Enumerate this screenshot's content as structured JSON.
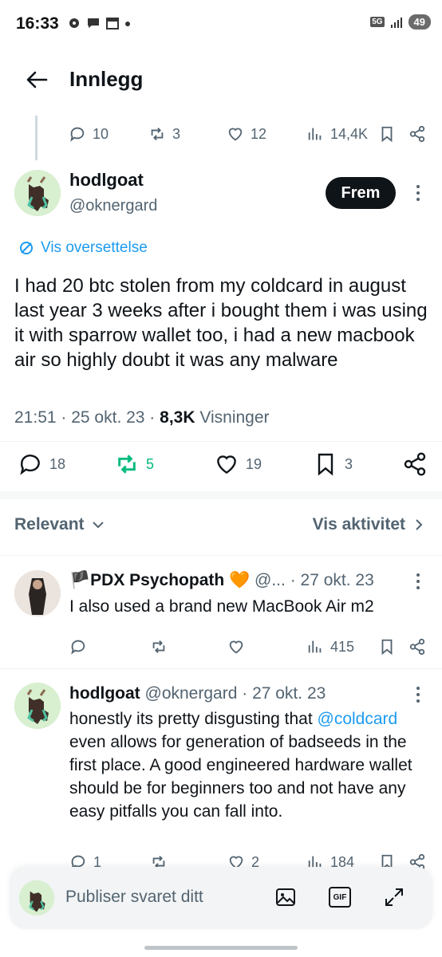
{
  "status_bar": {
    "time": "16:33",
    "net": "5G",
    "battery": "49"
  },
  "header": {
    "title": "Innlegg"
  },
  "parent_metrics": {
    "replies": "10",
    "reposts": "3",
    "likes": "12",
    "views": "14,4K"
  },
  "post": {
    "name": "hodlgoat",
    "handle": "@oknergard",
    "follow_label": "Frem",
    "translate_label": "Vis oversettelse",
    "text": "I had 20 btc stolen from my coldcard in august last year 3 weeks after i bought them i was using it with sparrow wallet too, i had a new macbook air so highly doubt it was any malware",
    "time": "21:51",
    "date": "25 okt. 23",
    "views": "8,3K",
    "views_label": "Visninger",
    "replies": "18",
    "reposts": "5",
    "likes": "19",
    "bookmarks": "3"
  },
  "sort": {
    "relevant_label": "Relevant",
    "activity_label": "Vis aktivitet"
  },
  "replies": [
    {
      "name": "🏴PDX Psychopath 🧡",
      "handle": "@...",
      "date": "27 okt. 23",
      "text": "I also used a brand new MacBook Air m2",
      "views": "415"
    },
    {
      "name": "hodlgoat",
      "handle": "@oknergard",
      "date": "27 okt. 23",
      "text_mention": "@coldcard",
      "text_before": "honestly its pretty disgusting that ",
      "text_after": " even allows for generation of badseeds in the first place. A good engineered hardware wallet should be for beginners too and not have any easy pitfalls you can fall into.",
      "replies": "1",
      "likes": "2",
      "views": "184"
    }
  ],
  "composer": {
    "placeholder": "Publiser svaret ditt",
    "gif_label": "GIF"
  },
  "colors": {
    "accent": "#1d9bf0",
    "repost_active": "#00ba7c",
    "text": "#0f1419",
    "muted": "#536471"
  }
}
